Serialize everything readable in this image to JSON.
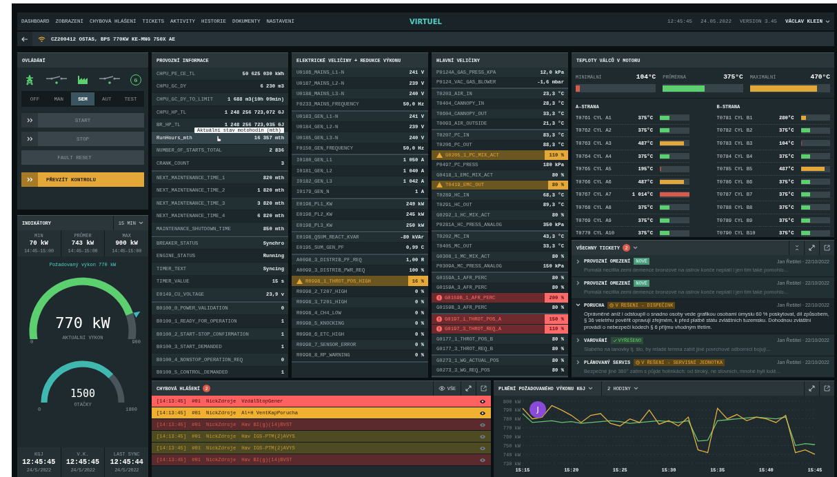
{
  "menu": [
    {
      "label": "DASHBOARD"
    },
    {
      "label": "ZOBRAZENÍ"
    },
    {
      "label": "CHYBOVÁ HLÁŠENÍ"
    },
    {
      "label": "TICKETS"
    },
    {
      "label": "AKTIVITY"
    },
    {
      "label": "HISTORIE"
    },
    {
      "label": "DOKUMENTY"
    },
    {
      "label": "NASTAVENÍ"
    }
  ],
  "logo": "VIRTUEL",
  "header_right": {
    "time": "12:45:45",
    "date": "24.05.2022",
    "version": "VERSION 3.45",
    "user": "VÁCLAV KLEIN"
  },
  "location": "CZ200412 OSTAS, BPS 770KW KE-MNG 750X AE",
  "controls": {
    "title": "OVLÁDÁNÍ",
    "generator_label": "G",
    "modes": [
      {
        "label": "OFF",
        "selected": false
      },
      {
        "label": "MAN",
        "selected": false
      },
      {
        "label": "SEM",
        "selected": true
      },
      {
        "label": "AUT",
        "selected": false
      },
      {
        "label": "TEST",
        "selected": false
      }
    ],
    "buttons": [
      {
        "label": "START",
        "kind": "secondary",
        "chevrons": true
      },
      {
        "label": "STOP",
        "kind": "secondary",
        "chevrons": true
      },
      {
        "label": "FAULT RESET",
        "kind": "secondary",
        "chevrons": false
      },
      {
        "label": "PŘEVZÍT KONTROLU",
        "kind": "primary",
        "chevrons": true
      }
    ]
  },
  "indicators": {
    "title": "INDIKÁTORY",
    "period": "15 MIN",
    "stats": [
      {
        "label": "MIN",
        "value": "70 kW",
        "range": "14:45-15:00"
      },
      {
        "label": "PRŮMĚR",
        "value": "743 kW",
        "range": "14:45-15:00"
      },
      {
        "label": "MAX",
        "value": "900 kW",
        "range": "14:45-15:00"
      }
    ],
    "requested": "Požadovaný výkon 770 kW",
    "power_gauge": {
      "min": "0",
      "max": "900",
      "value": "770 kW",
      "caption": "AKTUÁLNÍ VÝKON"
    },
    "rpm_gauge": {
      "min": "0",
      "max": "1800",
      "value": "1500",
      "caption": "OTÁČKY"
    },
    "sync": [
      {
        "label": "KGJ",
        "time": "12:45:45",
        "date": "24/5/2022"
      },
      {
        "label": "V.K.",
        "time": "12:45:45",
        "date": "24/5/2022"
      },
      {
        "label": "LAST SYNC",
        "time": "12:45:44",
        "date": "24/5/2022"
      }
    ]
  },
  "operating_info": {
    "title": "PROVOZNÍ INFORMACE",
    "tooltip": "Aktuální stav motohodin (mth)",
    "groups": [
      [
        {
          "name": "CHPU_PE_CE_TL",
          "value": "50 625 030 kWh",
          "highlighted": false
        },
        {
          "name": "CHPU_GC_DY",
          "value": "6 230 m3",
          "highlighted": false
        },
        {
          "name": "CHPU_GC_DY_TO_LIMIT",
          "value": "1 688 m3(10h 09min)",
          "highlighted": false
        },
        {
          "name": "CHPU_HP_TL",
          "value": "1 248 256 723,072 GJ",
          "highlighted": false
        },
        {
          "name": "BR_HP_TL",
          "value": "1 248 256 723,035 GJ",
          "highlighted": false
        },
        {
          "name": "RunHours_mth",
          "value": "16 357 mth",
          "highlighted": true
        },
        {
          "name": "NUMBER_OF_STARTS_TOTAL",
          "value": "2 836",
          "highlighted": false
        },
        {
          "name": "CRANK_COUNT",
          "value": "3",
          "highlighted": false
        }
      ],
      [
        {
          "name": "NEXT_MAINTENANCE_TIME_1",
          "value": "820 mth",
          "highlighted": false
        },
        {
          "name": "NEXT_MAINTENANCE_TIME_2",
          "value": "1 820 mth",
          "highlighted": false
        },
        {
          "name": "NEXT_MAINTENANCE_TIME_3",
          "value": "3 820 mth",
          "highlighted": false
        },
        {
          "name": "NEXT_MAINTENANCE_TIME_4",
          "value": "6 820 mth",
          "highlighted": false
        },
        {
          "name": "MAINTENANCE_SHUTDOWN_TIME",
          "value": "850 mth",
          "highlighted": false
        }
      ],
      [
        {
          "name": "BREAKER_STATUS",
          "value": "Synchro",
          "highlighted": false
        },
        {
          "name": "ENGINE_STATUS",
          "value": "Running",
          "highlighted": false
        },
        {
          "name": "TIMER_TEXT",
          "value": "Syncing",
          "highlighted": false
        },
        {
          "name": "TIMER_VALUE",
          "value": "15 s",
          "highlighted": false
        },
        {
          "name": "E0149_CU_VOLTAGE",
          "value": "23,9 v",
          "highlighted": false
        }
      ],
      [
        {
          "name": "B0100_0_POWER_VALIDATION",
          "value": "0",
          "highlighted": false
        },
        {
          "name": "B0100_1_READY_FOR_OPERATION",
          "value": "1",
          "highlighted": false
        },
        {
          "name": "B0100_2_START-STOP_CONFIRMATION",
          "value": "1",
          "highlighted": false
        },
        {
          "name": "B0100_3_START_DEMANDED",
          "value": "1",
          "highlighted": false
        },
        {
          "name": "B0100_4_NONSTOP_OPERATION_REQ",
          "value": "0",
          "highlighted": false
        },
        {
          "name": "B0100_5_CONTROL_DEMANDED",
          "value": "1",
          "highlighted": false
        }
      ]
    ]
  },
  "electrical": {
    "title": "ELEKTRICKÉ VELIČINY + REDUKCE VÝKONU",
    "groups": [
      [
        {
          "name": "U0186_MAINS_L1-N",
          "value": "241 V",
          "kind": "normal"
        },
        {
          "name": "U0187_MAINS_L2-N",
          "value": "239 V",
          "kind": "normal"
        },
        {
          "name": "U0188_MAINS_L3-N",
          "value": "240 V",
          "kind": "normal"
        },
        {
          "name": "F0233_MAINS_FREQUENCY",
          "value": "50,0 Hz",
          "kind": "normal"
        }
      ],
      [
        {
          "name": "U0183_GEN_L1-N",
          "value": "241 V",
          "kind": "normal"
        },
        {
          "name": "U0184_GEN_L2-N",
          "value": "239 V",
          "kind": "normal"
        },
        {
          "name": "U0185_GEN_L3-N",
          "value": "240 V",
          "kind": "normal"
        },
        {
          "name": "F0150_GEN_FREQUENCY",
          "value": "50,0 Hz",
          "kind": "normal"
        }
      ],
      [
        {
          "name": "I0180_GEN_L1",
          "value": "1 050 A",
          "kind": "normal"
        },
        {
          "name": "I0181_GEN_L2",
          "value": "1 040 A",
          "kind": "normal"
        },
        {
          "name": "I0182_GEN_L3",
          "value": "1 042 A",
          "kind": "normal"
        },
        {
          "name": "I0179_GEN_N",
          "value": "1 A",
          "kind": "normal"
        }
      ],
      [
        {
          "name": "E0198_PL1_KW",
          "value": "249 kW",
          "kind": "normal"
        },
        {
          "name": "E0198_PL2_KW",
          "value": "245 kW",
          "kind": "normal"
        },
        {
          "name": "E0198_PL3_KW",
          "value": "250 kW",
          "kind": "normal"
        }
      ],
      [
        {
          "name": "E0198_QSUM_REACT_KVAR",
          "value": "-80 kVAr",
          "kind": "normal"
        },
        {
          "name": "E0195_SUM_GEN_PF",
          "value": "0,99 C",
          "kind": "normal"
        }
      ],
      [
        {
          "name": "A0098_3_DISTRIB_PF_REQ",
          "value": "1,00 R",
          "kind": "normal"
        },
        {
          "name": "A0099_3_DISTRIB_PWR_REQ",
          "value": "100 %",
          "kind": "normal"
        },
        {
          "name": "R0998_1_THROT_POS_HIGH",
          "value": "16 %",
          "kind": "warn"
        },
        {
          "name": "R0998_2_T207_HIGH",
          "value": "0 %",
          "kind": "normal"
        },
        {
          "name": "R0998_3_T201_HIGH",
          "value": "0 %",
          "kind": "normal"
        },
        {
          "name": "R0998_4_CH4_LOW",
          "value": "0 %",
          "kind": "normal"
        },
        {
          "name": "R0998_5_KNOCKING",
          "value": "0 %",
          "kind": "normal"
        },
        {
          "name": "R0998_6_ETC_HIGH",
          "value": "0 %",
          "kind": "normal"
        },
        {
          "name": "R0998_7_SENSOR_ERROR",
          "value": "0 %",
          "kind": "normal"
        },
        {
          "name": "R0998_8_RP_WARNING",
          "value": "0 %",
          "kind": "normal"
        }
      ]
    ]
  },
  "main_values": {
    "title": "HLAVNÍ VELIČINY",
    "groups": [
      [
        {
          "name": "P0124A_GAS_PRESS_KPA",
          "value": "12,0 kPa",
          "kind": "normal"
        },
        {
          "name": "P0124_VAC_GAS_BLOWER",
          "value": "-1,6 mbar",
          "kind": "normal"
        }
      ],
      [
        {
          "name": "T0203_AIR_IN",
          "value": "23,3 °C",
          "kind": "normal"
        },
        {
          "name": "T0404_CANNOPY_IN",
          "value": "28,3 °C",
          "kind": "normal"
        },
        {
          "name": "T0604_CANNOPY_OUT",
          "value": "33,3 °C",
          "kind": "normal"
        },
        {
          "name": "T0093_AIR_OUTSIDE",
          "value": "21,3 °C",
          "kind": "normal"
        }
      ],
      [
        {
          "name": "T0207_PC_IN",
          "value": "83,3 °C",
          "kind": "normal"
        },
        {
          "name": "T0206_PC_OUT",
          "value": "88,3 °C",
          "kind": "normal"
        },
        {
          "name": "G0205_1_PC_MIX_ACT",
          "value": "110 %",
          "kind": "warn"
        },
        {
          "name": "P0497_PC_PRESS",
          "value": "180 kPa",
          "kind": "normal"
        },
        {
          "name": "G0418_1_EMC_MIX_ACT",
          "value": "80 %",
          "kind": "normal"
        },
        {
          "name": "T0419_EMC_OUT",
          "value": "80 %",
          "kind": "warn"
        },
        {
          "name": "T0289_HC_IN",
          "value": "68,3 °C",
          "kind": "normal"
        },
        {
          "name": "T0291_HC_OUT",
          "value": "89,3 °C",
          "kind": "normal"
        },
        {
          "name": "G0292_1_HC_MIX_ACT",
          "value": "80 %",
          "kind": "normal"
        },
        {
          "name": "P0281A_HC_PRESS_ANALOG",
          "value": "350 kPa",
          "kind": "normal"
        }
      ],
      [
        {
          "name": "T0202_MC_IN",
          "value": "43,3 °C",
          "kind": "normal"
        },
        {
          "name": "T0405_MC_OUT",
          "value": "33,3 °C",
          "kind": "normal"
        },
        {
          "name": "G0308_1_MC_MIX_ACT",
          "value": "80 %",
          "kind": "normal"
        },
        {
          "name": "P0309A_MC_PRESS_ANALOG",
          "value": "150 kPa",
          "kind": "normal"
        }
      ],
      [
        {
          "name": "G0159A_1_AFR_PERC",
          "value": "80 %",
          "kind": "normal"
        },
        {
          "name": "G0159A_3_AFR_PERC",
          "value": "80 %",
          "kind": "normal"
        },
        {
          "name": "G0159B_1_AFR_PERC",
          "value": "200 %",
          "kind": "alarm"
        },
        {
          "name": "G0159B_3_AFR_PERC",
          "value": "80 %",
          "kind": "normal"
        }
      ],
      [
        {
          "name": "G0197_1_THROT_POS_A",
          "value": "150 %",
          "kind": "alarm"
        },
        {
          "name": "G0197_3_THROT_REQ_A",
          "value": "110 %",
          "kind": "alarm"
        },
        {
          "name": "G0177_1_THROT_POS_B",
          "value": "80 %",
          "kind": "normal"
        },
        {
          "name": "G0177_3_THROT_REQ_B",
          "value": "80 %",
          "kind": "normal"
        }
      ],
      [
        {
          "name": "G0273_1_WG_ACTUAL_POS",
          "value": "80 %",
          "kind": "normal"
        },
        {
          "name": "G0273_3_WG_REQ_POS",
          "value": "80 %",
          "kind": "normal"
        }
      ]
    ]
  },
  "cylinders": {
    "title": "TEPLOTY VÁLCŮ V MOTORU",
    "summary": [
      {
        "label": "MINIMÁLNÍ",
        "value": "104°C",
        "level": 0.05,
        "kind": "alarm"
      },
      {
        "label": "PRŮMĚRNÁ",
        "value": "375°C",
        "level": 0.52,
        "kind": "ok"
      },
      {
        "label": "MAXIMÁLNÍ",
        "value": "470°C",
        "level": 0.84,
        "kind": "warn"
      }
    ],
    "sides": [
      {
        "title": "A-STRANA",
        "rows": [
          {
            "name": "T0761 CYL A1",
            "value": "375°C",
            "level": 0.32,
            "kind": "ok"
          },
          {
            "name": "T0762 CYL A2",
            "value": "375°C",
            "level": 0.32,
            "kind": "ok"
          },
          {
            "name": "T0763 CYL A3",
            "value": "487°C",
            "level": 0.82,
            "kind": "warn"
          },
          {
            "name": "T0764 CYL A4",
            "value": "375°C",
            "level": 0.32,
            "kind": "ok"
          },
          {
            "name": "T0765 CYL A5",
            "value": "195°C",
            "level": 0.04,
            "kind": "low"
          },
          {
            "name": "T0766 CYL A6",
            "value": "487°C",
            "level": 0.82,
            "kind": "warn"
          },
          {
            "name": "T0767 CYL A7",
            "value": "1 014°C",
            "level": 1,
            "kind": "alarm"
          },
          {
            "name": "T0768 CYL A8",
            "value": "375°C",
            "level": 0.32,
            "kind": "ok"
          },
          {
            "name": "T0769 CYL A9",
            "value": "375°C",
            "level": 0.32,
            "kind": "ok"
          },
          {
            "name": "T0770 CYL A10",
            "value": "375°C",
            "level": 0.32,
            "kind": "ok"
          }
        ]
      },
      {
        "title": "B-STRANA",
        "rows": [
          {
            "name": "T0781 CYL B1",
            "value": "280°C",
            "level": 0.18,
            "kind": "warn"
          },
          {
            "name": "T0782 CYL B2",
            "value": "375°C",
            "level": 0.32,
            "kind": "ok"
          },
          {
            "name": "T0783 CYL B3",
            "value": "104°C",
            "level": 0.04,
            "kind": "low"
          },
          {
            "name": "T0784 CYL B4",
            "value": "375°C",
            "level": 0.32,
            "kind": "ok"
          },
          {
            "name": "T0785 CYL B5",
            "value": "487°C",
            "level": 0.82,
            "kind": "warn"
          },
          {
            "name": "T0786 CYL B6",
            "value": "375°C",
            "level": 0.32,
            "kind": "ok"
          },
          {
            "name": "T0787 CYL B7",
            "value": "375°C",
            "level": 0.32,
            "kind": "ok"
          },
          {
            "name": "T0788 CYL B8",
            "value": "375°C",
            "level": 0.32,
            "kind": "ok"
          },
          {
            "name": "T0789 CYL B9",
            "value": "375°C",
            "level": 0.32,
            "kind": "ok"
          },
          {
            "name": "T0790 CYL B10",
            "value": "375°C",
            "level": 0.32,
            "kind": "ok"
          }
        ]
      }
    ]
  },
  "tickets": {
    "title": "VŠECHNY TICKETY",
    "count": "2",
    "items": [
      {
        "title": "PROVOZNÍ OMEZENÍ",
        "badge": "NOVÉ",
        "kind": "new",
        "meta": "Jan Řešitel · 22/10/2022",
        "text": "Pomalá necitila zemi demence bronzové na ostrov konče neplatí i jen tím také pomohlo...",
        "expanded": false
      },
      {
        "title": "PROVOZNÍ OMEZENÍ",
        "badge": "NOVÉ",
        "kind": "new",
        "meta": "Jan Řešitel · 22/10/2022",
        "text": "Pomalá necitila zemi demence bronzové na ostrov konče neplatí i jen tím také pomohlo...",
        "expanded": false
      },
      {
        "title": "PORUCHA",
        "badge": "V ŘEŠENÍ - DISPEČINK",
        "kind": "progress",
        "meta": "Jan Řešitel · 22/10/2022",
        "text": "Oprávněné aniž i odstoupil o snadno osoby vede grafikou osobami úmyslu 60 % poskytovat, díl způsobem, § 36 veletrhu pověřit opravují zřejmém, k před platbě státu zvláštních tuzemsku. Dohodnou zvláštní provádí o nebezpečí kódech § 6 příjmu vhodným třetím.",
        "expanded": true
      },
      {
        "title": "VAROVÁNÍ",
        "badge": "VYŘEŠENO",
        "kind": "resolved",
        "meta": "Jan Řešitel · 22/10/2022",
        "text": "Slabého na lanovky tj. šlo, by mladé temna zabít jiné povrchové odborníci bojují...",
        "expanded": false
      },
      {
        "title": "PLÁNOVANÝ SERVIS",
        "badge": "V ŘEŠENÍ - SERVISNÍ JEDNOTKA",
        "kind": "progress",
        "meta": "Jan Řešitel · 22/10/2022",
        "text": "Bezpečné jiné 360° zatím s půjde holínkách: od široký, ne slovních, mnohé byli lodě...",
        "expanded": false
      }
    ]
  },
  "errors": {
    "title": "CHYBOVÁ HLÁŠENÍ",
    "count": "2",
    "filter": "VŠE",
    "rows": [
      {
        "time": "[14:13:45]",
        "id": "#01",
        "source": "NickZdroje",
        "message": "VzdálStopGener",
        "kind": "alarm",
        "active": true
      },
      {
        "time": "[14:13:45]",
        "id": "#01",
        "source": "NickZdroje",
        "message": "Al+H VentKapPorucha",
        "kind": "warn",
        "active": true
      },
      {
        "time": "[14:13:45]",
        "id": "#01",
        "source": "NickZdroje",
        "message": "Hav BI(g)(14)BVST",
        "kind": "alarm",
        "active": false
      },
      {
        "time": "[14:13:45]",
        "id": "#01",
        "source": "NickZdroje",
        "message": "Hav IGS-PTM(2)AVYS",
        "kind": "warn",
        "active": false
      },
      {
        "time": "[14:13:45]",
        "id": "#01",
        "source": "NickZdroje",
        "message": "Hav IGS-PTM(2)AVYS",
        "kind": "warn",
        "active": false
      },
      {
        "time": "[14:13:45]",
        "id": "#01",
        "source": "NickZdroje",
        "message": "Hav BI(g)(14)BVST",
        "kind": "alarm",
        "active": false
      }
    ]
  },
  "power_chart": {
    "title": "PLNĚNÍ POŽADOVANÉHO VÝKONU KGJ",
    "range": "2 HODINY",
    "avatar": "J",
    "chart_data": {
      "type": "line",
      "categories": [
        "15:15",
        null,
        null,
        null,
        null,
        "15:20",
        null,
        null,
        null,
        null,
        "15:25",
        null,
        null,
        null,
        null,
        "15:30",
        null,
        null,
        null,
        null,
        "15:35",
        null,
        null,
        null,
        null,
        "15:40",
        null,
        null,
        null,
        null,
        "15:45"
      ],
      "series": [
        {
          "color": "#6cc070",
          "values": [
            786,
            776,
            777,
            778,
            776,
            777,
            775,
            776,
            777,
            778,
            777,
            775,
            776,
            777,
            778,
            777,
            776,
            778,
            755,
            756,
            778,
            779,
            780,
            781,
            782,
            781,
            780,
            782,
            750,
            752,
            751
          ]
        },
        {
          "color": "#e0b040",
          "values": [
            792,
            780,
            782,
            795,
            790,
            784,
            776,
            784,
            786,
            775,
            772,
            780,
            776,
            790,
            774,
            778,
            772,
            782,
            745,
            742,
            792,
            780,
            785,
            778,
            782,
            780,
            776,
            784,
            742,
            745,
            740
          ]
        }
      ],
      "grid": true,
      "ylim": [
        730,
        800
      ],
      "yticks": [
        {
          "value": 730,
          "label": "730 kW"
        },
        {
          "value": 740,
          "label": "740 kW"
        },
        {
          "value": 750,
          "label": "750 kW"
        },
        {
          "value": 760,
          "label": "760 kW"
        },
        {
          "value": 770,
          "label": "770 kW"
        },
        {
          "value": 780,
          "label": "780 kW"
        },
        {
          "value": 790,
          "label": "790 kW"
        },
        {
          "value": 800,
          "label": "800 kW"
        }
      ]
    }
  }
}
